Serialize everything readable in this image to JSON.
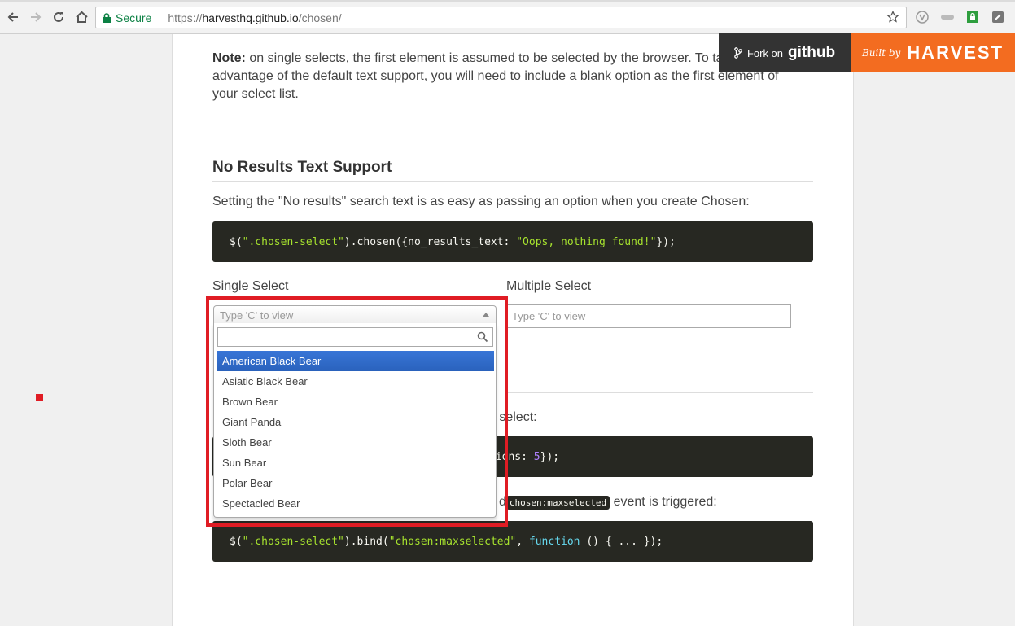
{
  "browser": {
    "secure_label": "Secure",
    "url_scheme": "https://",
    "url_host": "harvesthq.github.io",
    "url_path": "/chosen/"
  },
  "banners": {
    "fork_prefix": "Fork on",
    "fork_brand": "github",
    "built_by": "Built by",
    "harvest": "HARVEST"
  },
  "content": {
    "note_label": "Note:",
    "note_text": " on single selects, the first element is assumed to be selected by the browser. To take full advantage of the default text support, you will need to include a blank option as the first element of your select list.",
    "section_title": "No Results Text Support",
    "section_desc": "Setting the \"No results\" search text is as easy as passing an option when you create Chosen:",
    "code1": {
      "a": "$(",
      "b": "\".chosen-select\"",
      "c": ").chosen({no_results_text: ",
      "d": "\"Oops, nothing found!\"",
      "e": "});"
    },
    "single_label": "Single Select",
    "multiple_label": "Multiple Select",
    "multi_placeholder": "Type 'C' to view",
    "partial_text1": "n select:",
    "code2_tail_a": "tions: ",
    "code2_tail_num": "5",
    "code2_tail_b": "});",
    "partial_text2_pre": "d",
    "inline_code": "chosen:maxselected",
    "partial_text2_post": " event is triggered:",
    "code3": {
      "a": "$(",
      "b": "\".chosen-select\"",
      "c": ").bind(",
      "d": "\"chosen:maxselected\"",
      "e": ", ",
      "f": "function",
      "g": " () { ... });"
    }
  },
  "chosen": {
    "placeholder": "Type 'C' to view",
    "search_value": "",
    "options": [
      "American Black Bear",
      "Asiatic Black Bear",
      "Brown Bear",
      "Giant Panda",
      "Sloth Bear",
      "Sun Bear",
      "Polar Bear",
      "Spectacled Bear"
    ],
    "highlighted": "American Black Bear"
  },
  "colors": {
    "annotation_red": "#e01c24",
    "highlight_blue": "#3875d7",
    "harvest_orange": "#f36c20"
  }
}
